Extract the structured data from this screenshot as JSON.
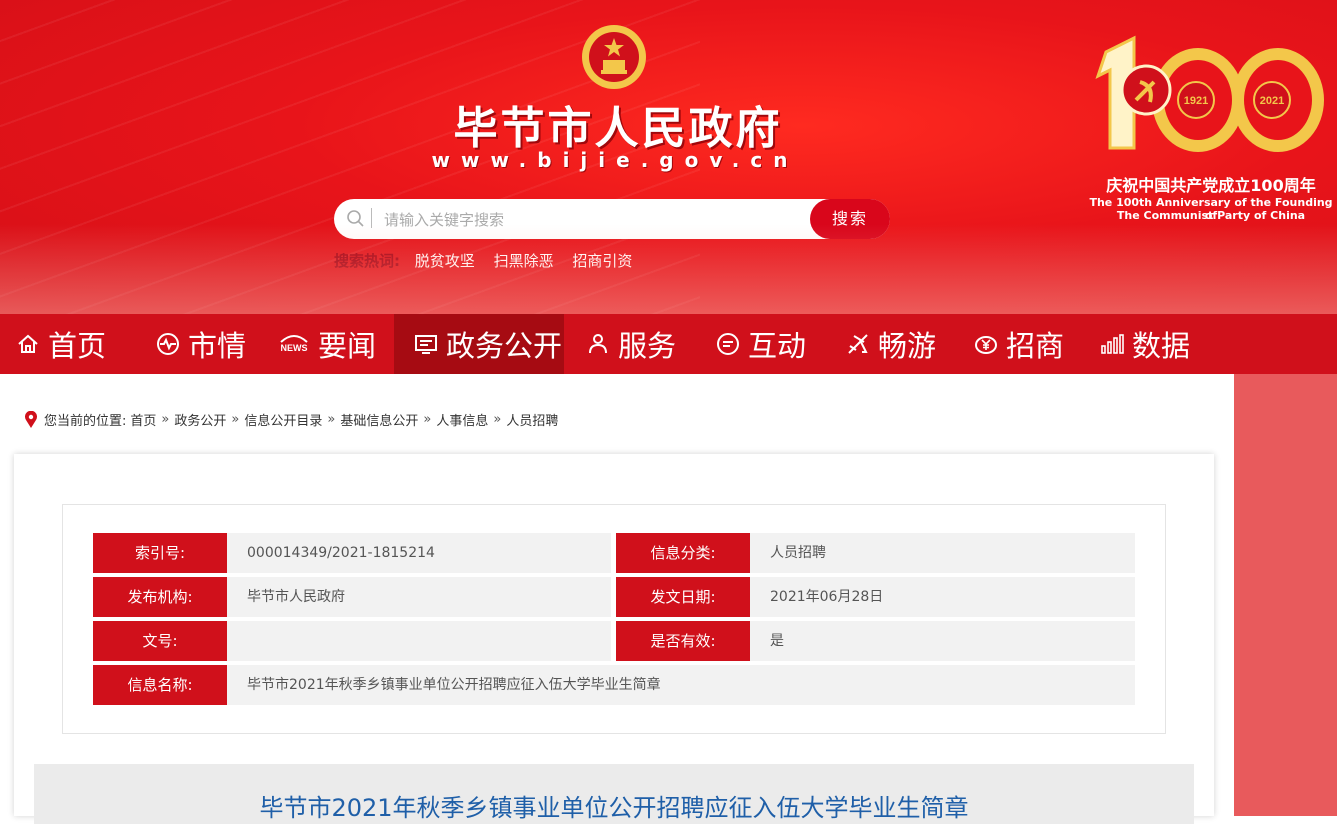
{
  "header": {
    "site_title": "毕节市人民政府",
    "site_url": "www.bijie.gov.cn",
    "search_placeholder": "请输入关键字搜索",
    "search_button": "搜索",
    "hot_label": "搜索热词:",
    "hot_words": [
      "脱贫攻坚",
      "扫黑除恶",
      "招商引资"
    ],
    "anniversary": {
      "years": [
        "1921",
        "2021"
      ],
      "number": "100",
      "cn": "庆祝中国共产党成立100周年",
      "en_line1": "The 100th Anniversary of the Founding of",
      "en_line2": "The Communist Party of China"
    }
  },
  "nav": {
    "items": [
      {
        "label": "首页",
        "icon": "home-icon"
      },
      {
        "label": "市情",
        "icon": "pulse-icon"
      },
      {
        "label": "要闻",
        "icon": "news-icon"
      },
      {
        "label": "政务公开",
        "icon": "monitor-icon",
        "active": true
      },
      {
        "label": "服务",
        "icon": "users-icon"
      },
      {
        "label": "互动",
        "icon": "chat-icon"
      },
      {
        "label": "畅游",
        "icon": "plane-icon"
      },
      {
        "label": "招商",
        "icon": "yen-icon"
      },
      {
        "label": "数据",
        "icon": "bar-chart-icon"
      }
    ]
  },
  "breadcrumb": {
    "prefix": "您当前的位置:",
    "items": [
      "首页",
      "政务公开",
      "信息公开目录",
      "基础信息公开",
      "人事信息",
      "人员招聘"
    ],
    "separator": "»"
  },
  "meta": {
    "index_label": "索引号:",
    "index_value": "000014349/2021-1815214",
    "category_label": "信息分类:",
    "category_value": "人员招聘",
    "publisher_label": "发布机构:",
    "publisher_value": "毕节市人民政府",
    "date_label": "发文日期:",
    "date_value": "2021年06月28日",
    "docno_label": "文号:",
    "docno_value": "",
    "valid_label": "是否有效:",
    "valid_value": "是",
    "name_label": "信息名称:",
    "name_value": "毕节市2021年秋季乡镇事业单位公开招聘应征入伍大学毕业生简章"
  },
  "article": {
    "title": "毕节市2021年秋季乡镇事业单位公开招聘应征入伍大学毕业生简章"
  },
  "colors": {
    "brand_red": "#d0101b",
    "nav_active": "#a60b12",
    "link_blue": "#1f5fa8"
  }
}
